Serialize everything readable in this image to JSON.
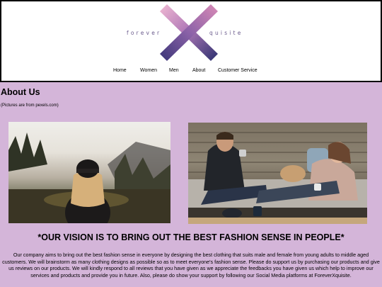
{
  "header": {
    "logo_left": "forever",
    "logo_right": "quisite",
    "logo_colors": {
      "pink": "#e8a6c6",
      "purple": "#6a4f9c",
      "navy": "#2b2f6e"
    }
  },
  "nav": {
    "items": [
      "Home",
      "Women",
      "Men",
      "About",
      "Customer Service"
    ]
  },
  "main": {
    "title": "About Us",
    "credit": "(Pictures are from pexels.com)",
    "images": [
      {
        "name": "woman-in-beanie-forest-photo"
      },
      {
        "name": "couple-with-dog-on-sofa-photo"
      }
    ],
    "vision": "*OUR VISION IS TO BRING OUT THE BEST FASHION SENSE IN PEOPLE*",
    "paragraph": "Our company aims to bring out the best fashion sense in everyone by designing the best clothing that suits male and female from young adults to middle aged customers. We will brainstorm as many clothing designs as possible so as to meet everyone's fashion sense. Please do support us by purchasing our products and give us reviews on our products. We will kindly respond to all reviews that you have given as we appreciate the feedbacks you have given us which help to improve our services and products and provide you in future. Also, please do show your support by following our Social Media platforms at ForeverXquisite."
  },
  "colors": {
    "page_background": "#d4b5d9",
    "header_background": "#ffffff"
  }
}
